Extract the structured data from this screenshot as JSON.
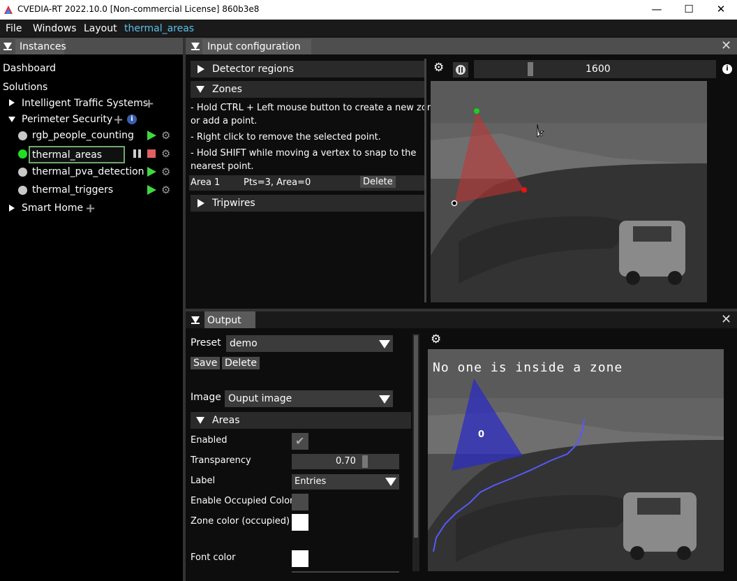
{
  "window": {
    "title": "CVEDIA-RT 2022.10.0    [Non-commercial License] 860b3e8",
    "minimize": "—",
    "maximize": "☐",
    "close": "✕"
  },
  "menu": {
    "file": "File",
    "windows": "Windows",
    "layout": "Layout",
    "active": "thermal_areas"
  },
  "instances": {
    "tab": "Instances",
    "dashboard": "Dashboard",
    "solutions": "Solutions",
    "groups": [
      {
        "label": "Intelligent Traffic Systems"
      },
      {
        "label": "Perimeter Security"
      },
      {
        "label": "Smart Home"
      }
    ],
    "items": [
      "rgb_people_counting",
      "thermal_areas",
      "thermal_pva_detection",
      "thermal_triggers"
    ]
  },
  "input": {
    "tab": "Input configuration",
    "detector_regions": "Detector regions",
    "zones": "Zones",
    "help1": "- Hold CTRL + Left mouse button to create a new zone",
    "help1b": "or add a point.",
    "help2": "- Right click to remove the selected point.",
    "help3": "- Hold SHIFT while moving a vertex to snap to the",
    "help3b": "nearest point.",
    "area_name": "Area 1",
    "area_info": "Pts=3, Area=0",
    "delete": "Delete",
    "tripwires": "Tripwires",
    "frame": "1600"
  },
  "output": {
    "tab": "Output",
    "preset_label": "Preset",
    "preset_value": "demo",
    "save": "Save",
    "delete": "Delete",
    "image_label": "Image",
    "image_value": "Ouput image",
    "areas": "Areas",
    "enabled": "Enabled",
    "transparency": "Transparency",
    "transparency_value": "0.70",
    "label": "Label",
    "label_value": "Entries",
    "enable_occupied": "Enable Occupied Color",
    "zone_color": "Zone color (occupied)",
    "font_color": "Font color",
    "overlay_text": "No one is inside a zone",
    "zone_count": "0"
  },
  "colors": {
    "accent": "#5bc0eb",
    "play": "#3fd93f",
    "zone_red": "#c83232",
    "zone_blue": "#2828c8"
  }
}
